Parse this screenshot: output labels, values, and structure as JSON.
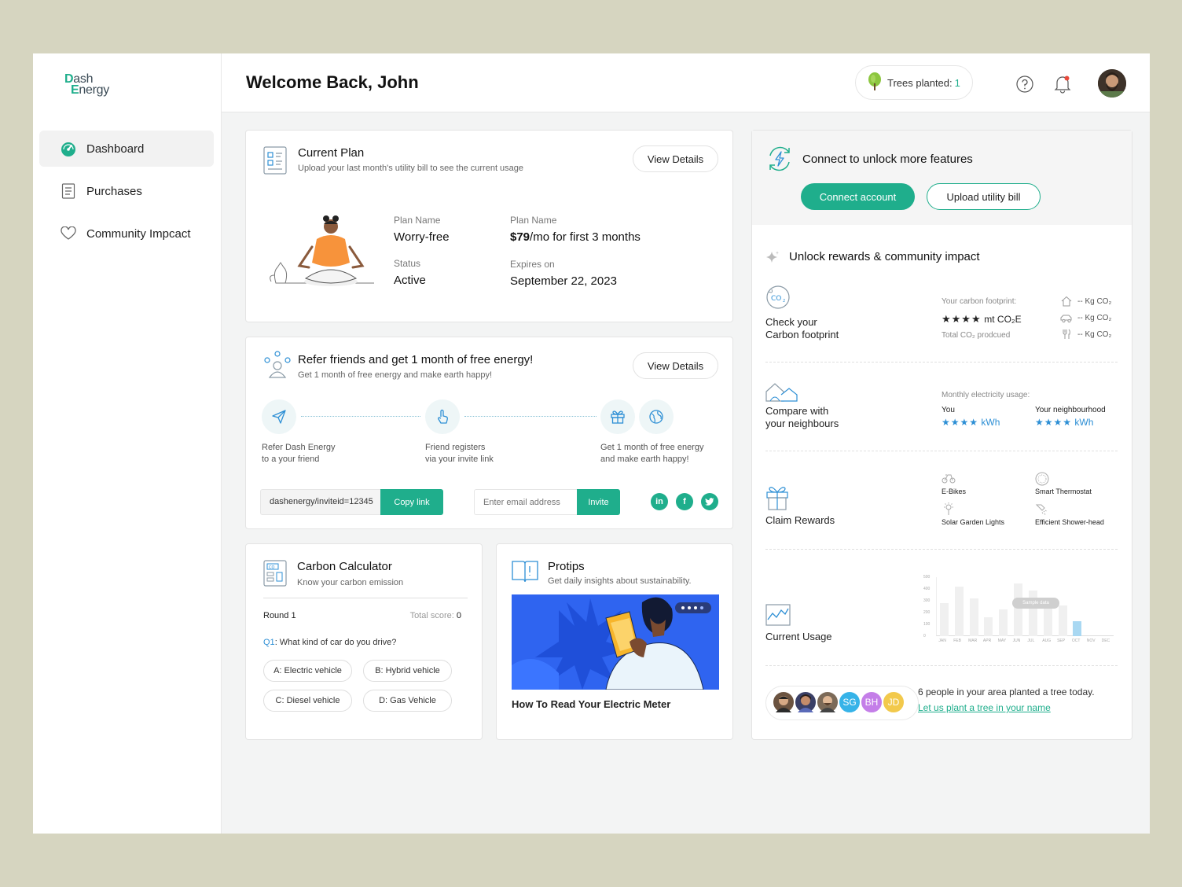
{
  "brand": {
    "line1_a": "D",
    "line1_b": "ash",
    "line2_a": "E",
    "line2_b": "nergy"
  },
  "sidebar": {
    "items": [
      {
        "label": "Dashboard",
        "icon": "speedometer-icon"
      },
      {
        "label": "Purchases",
        "icon": "receipt-icon"
      },
      {
        "label": "Community Impcact",
        "icon": "heart-icon"
      }
    ]
  },
  "header": {
    "welcome": "Welcome Back, John",
    "trees_label": "Trees planted:",
    "trees_count": "1"
  },
  "current_plan": {
    "title": "Current Plan",
    "subtitle": "Upload your last month's utility bill to see the current usage",
    "view_details": "View Details",
    "plan_name_label": "Plan Name",
    "plan_name": "Worry-free",
    "price_label": "Plan Name",
    "price_bold": "$79",
    "price_rest": "/mo for first 3 months",
    "status_label": "Status",
    "status": "Active",
    "expires_label": "Expires on",
    "expires": "September 22, 2023"
  },
  "refer": {
    "title": "Refer friends and get 1 month of free energy!",
    "subtitle": "Get 1 month of free energy and make earth happy!",
    "view_details": "View Details",
    "step1_l1": "Refer Dash Energy",
    "step1_l2": "to a your friend",
    "step2_l1": "Friend registers",
    "step2_l2": "via your invite link",
    "step3_l1": "Get 1 month of free energy",
    "step3_l2": "and make earth happy!",
    "invite_link": "dashenergy/inviteid=12345",
    "copy_label": "Copy link",
    "email_placeholder": "Enter email address",
    "invite_label": "Invite",
    "social": [
      "in",
      "f",
      "t"
    ]
  },
  "carbon_calc": {
    "title": "Carbon Calculator",
    "subtitle": "Know your carbon emission",
    "round": "Round 1",
    "total_label": "Total score:",
    "total_value": "0",
    "question_prefix": "Q1",
    "question": ": What kind of car do you drive?",
    "options": [
      "A: Electric vehicle",
      "B: Hybrid vehicle",
      "C: Diesel vehicle",
      "D: Gas Vehicle"
    ]
  },
  "protips": {
    "title": "Protips",
    "subtitle": "Get daily insights about sustainability.",
    "article": "How To Read Your Electric Meter"
  },
  "connect": {
    "title": "Connect to unlock more features",
    "connect_btn": "Connect account",
    "upload_btn": "Upload utility bill"
  },
  "rewards": {
    "title": "Unlock rewards & community impact",
    "carbon": {
      "l1": "Check your",
      "l2": "Carbon footprint",
      "footprint_label": "Your carbon footprint:",
      "footprint_value": "★★★★",
      "footprint_unit": "mt CO₂E",
      "total_label": "Total CO₂ prodcued",
      "rows": [
        "-- Kg CO₂",
        "-- Kg CO₂",
        "-- Kg CO₂"
      ]
    },
    "compare": {
      "l1": "Compare with",
      "l2": "your neighbours",
      "usage_label": "Monthly electricity usage:",
      "you_label": "You",
      "you_value": "★★★★",
      "you_unit": "kWh",
      "neigh_label": "Your neighbourhood",
      "neigh_value": "★★★★",
      "neigh_unit": "kWh"
    },
    "claim": {
      "label": "Claim Rewards",
      "items": [
        "E-Bikes",
        "Smart Thermostat",
        "Solar Garden Lights",
        "Efficient Shower-head"
      ]
    },
    "usage": {
      "label": "Current Usage",
      "badge": "Sample data"
    },
    "community": {
      "initials": [
        "SG",
        "BH",
        "JD"
      ],
      "text": "6 people in your area planted a tree today.",
      "link": "Let us plant a tree in your name"
    }
  },
  "chart_data": {
    "type": "bar",
    "title": "",
    "categories": [
      "JAN",
      "FEB",
      "MAR",
      "APR",
      "MAY",
      "JUN",
      "JUL",
      "AUG",
      "SEP",
      "OCT",
      "NOV",
      "DEC"
    ],
    "ticks": [
      "500",
      "400",
      "300",
      "200",
      "100",
      "0"
    ],
    "series": [
      {
        "values": [
          280,
          420,
          320,
          160,
          230,
          450,
          390,
          280,
          260,
          130,
          0,
          0
        ]
      }
    ],
    "highlight_index": 9,
    "ylim": [
      0,
      500
    ],
    "colors": {
      "bar": "#f0f0f0",
      "highlight": "#a9d8f2"
    }
  },
  "colors": {
    "accent": "#1fae8c",
    "blue": "#2d8fd5"
  }
}
